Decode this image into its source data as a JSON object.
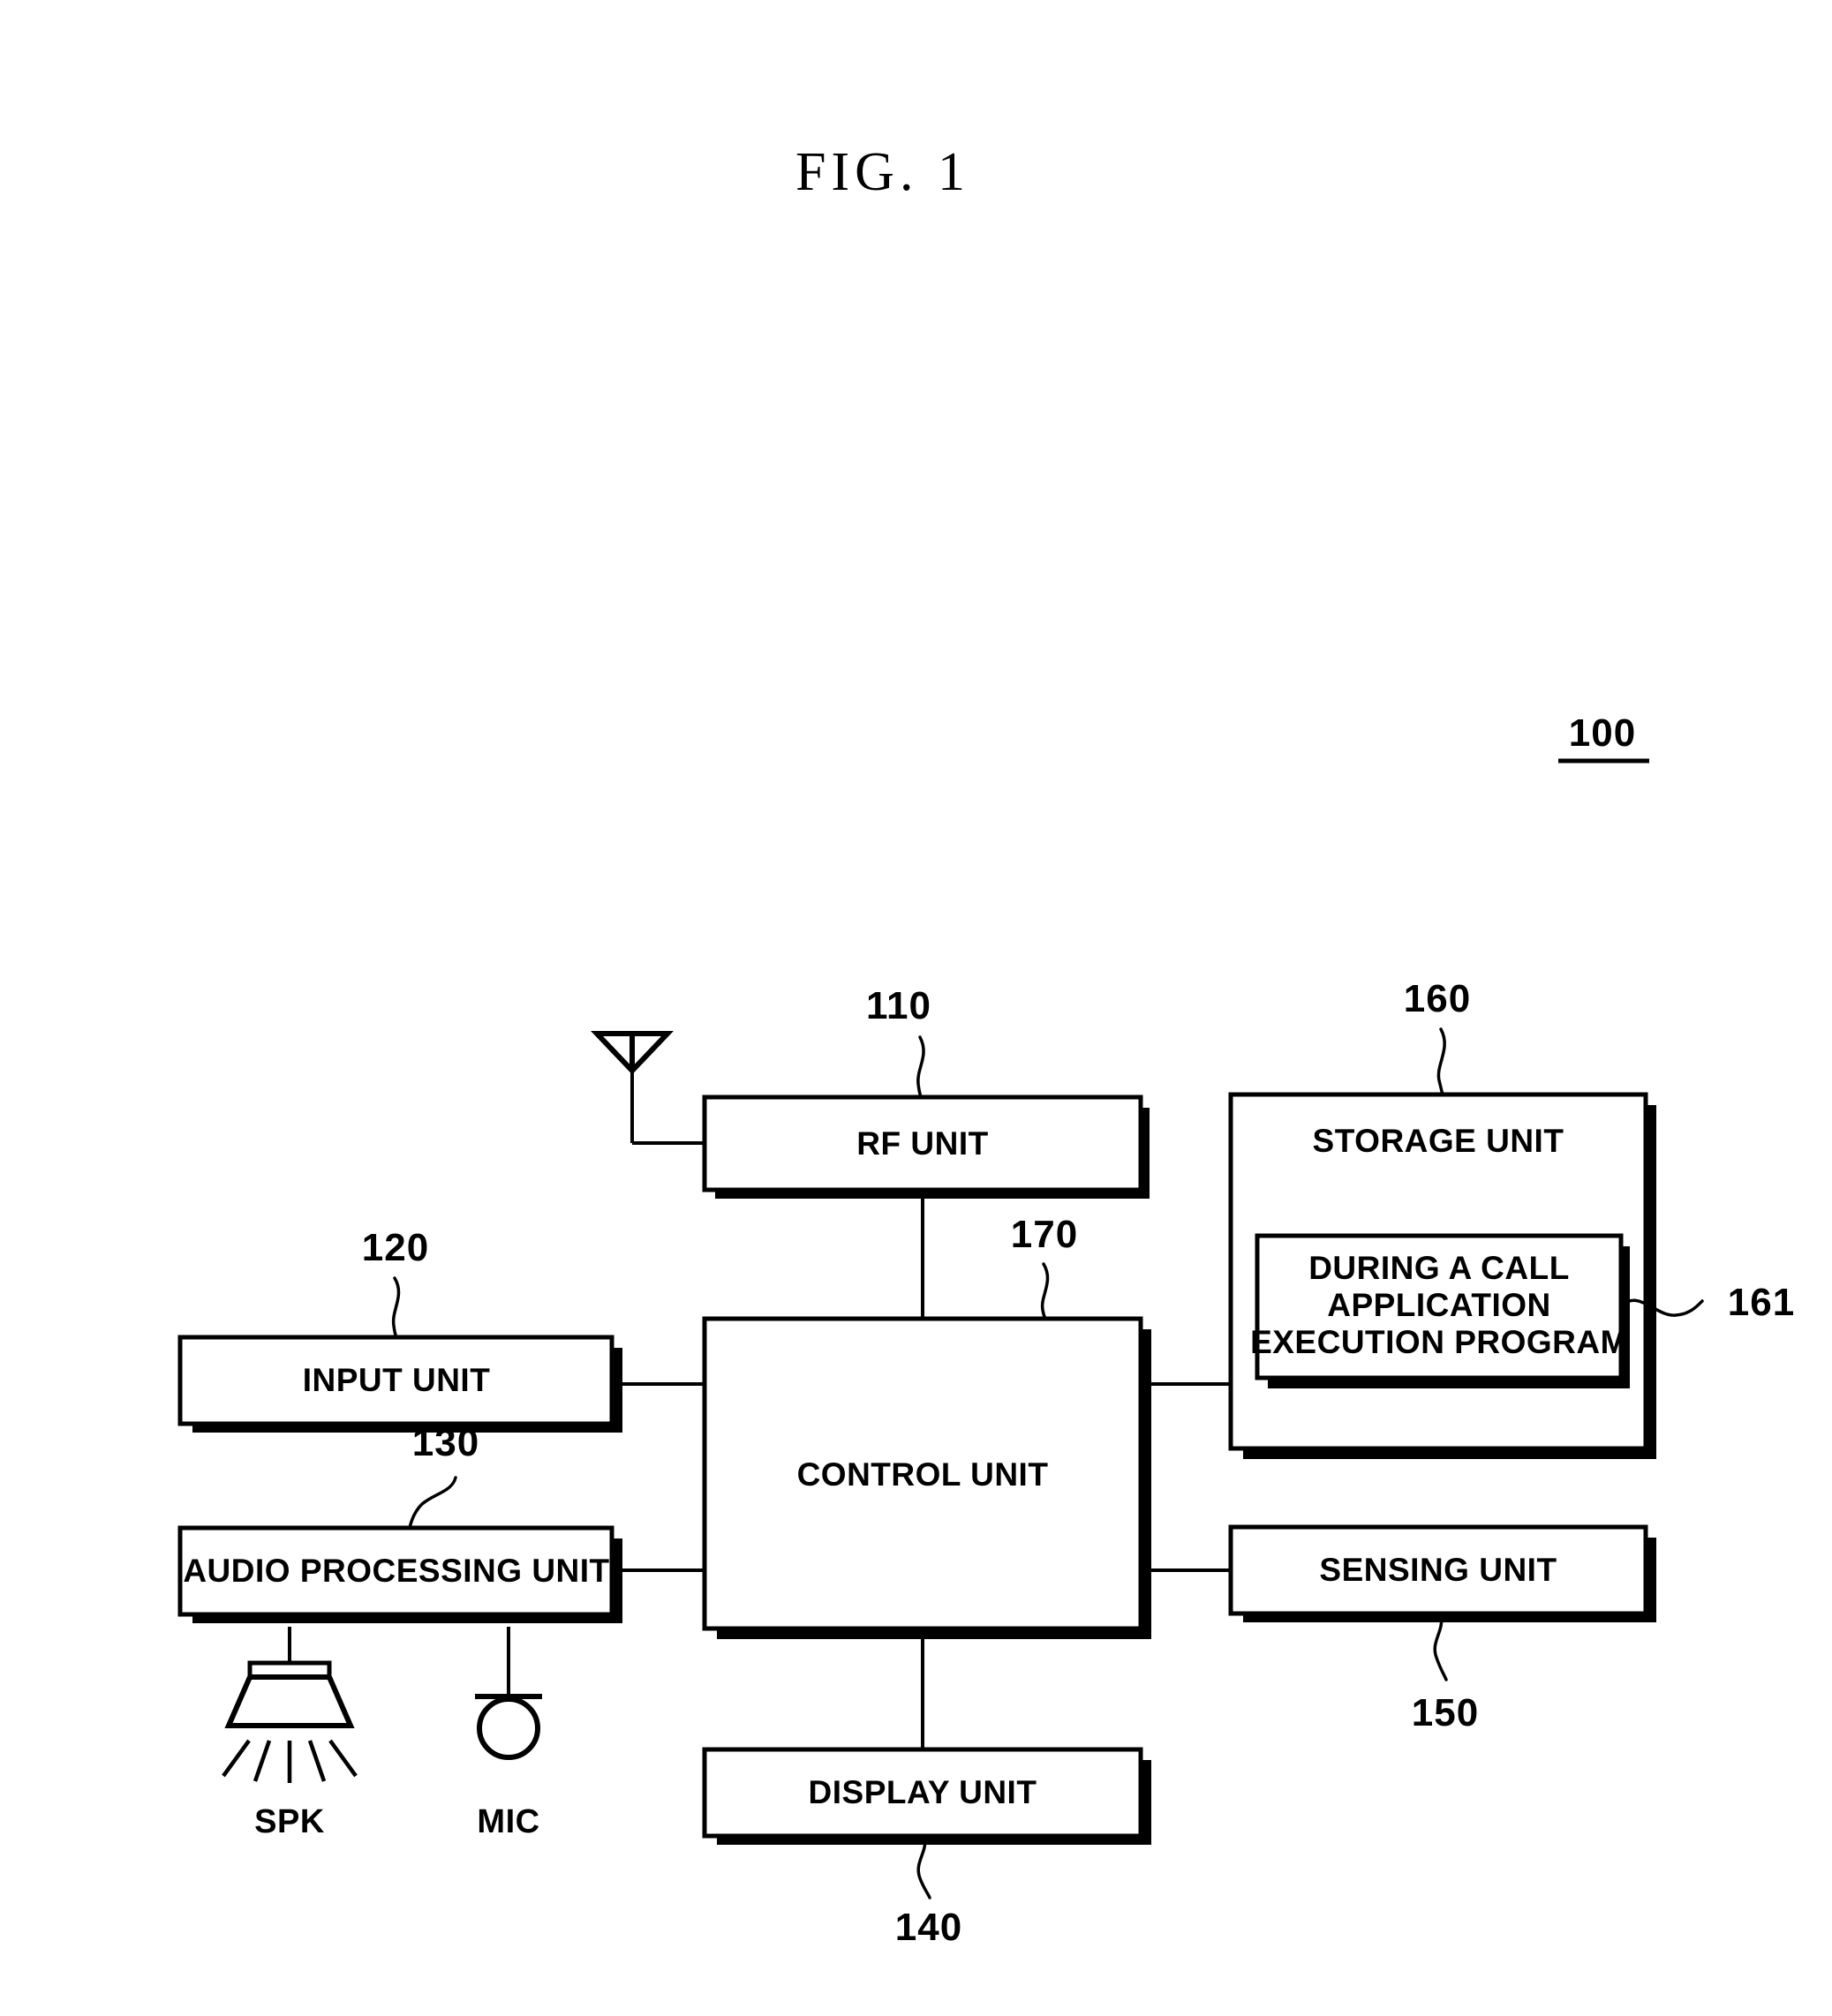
{
  "figure": {
    "title": "FIG. 1",
    "device_ref": "100"
  },
  "blocks": {
    "rf_unit": {
      "label": "RF UNIT",
      "ref": "110"
    },
    "input_unit": {
      "label": "INPUT UNIT",
      "ref": "120"
    },
    "audio_processing_unit": {
      "label": "AUDIO PROCESSING UNIT",
      "ref": "130"
    },
    "display_unit": {
      "label": "DISPLAY UNIT",
      "ref": "140"
    },
    "sensing_unit": {
      "label": "SENSING UNIT",
      "ref": "150"
    },
    "storage_unit": {
      "label": "STORAGE UNIT",
      "ref": "160"
    },
    "control_unit": {
      "label": "CONTROL UNIT",
      "ref": "170"
    },
    "execution_program": {
      "line1": "DURING A CALL",
      "line2": "APPLICATION",
      "line3": "EXECUTION PROGRAM",
      "ref": "161"
    }
  },
  "peripherals": {
    "speaker": {
      "label": "SPK",
      "icon": "speaker-icon"
    },
    "microphone": {
      "label": "MIC",
      "icon": "microphone-icon"
    },
    "antenna": {
      "icon": "antenna-icon"
    }
  },
  "colors": {
    "ink": "#000000",
    "paper": "#ffffff"
  }
}
